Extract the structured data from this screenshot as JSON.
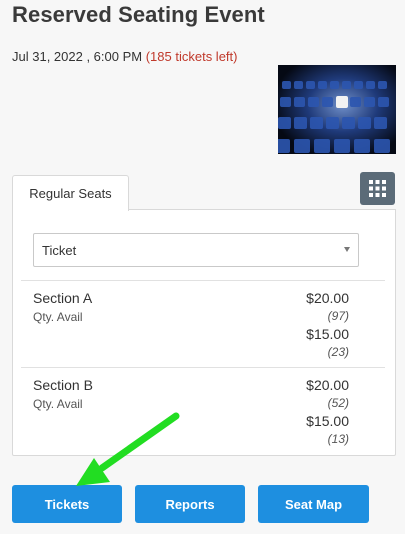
{
  "event": {
    "title": "Reserved Seating Event",
    "datetime": "Jul 31, 2022 , 6:00 PM",
    "tickets_left": "(185 tickets left)"
  },
  "tabs": [
    {
      "label": "Regular Seats"
    }
  ],
  "ticket_select": {
    "value": "Ticket"
  },
  "sections": [
    {
      "name": "Section A",
      "qty_label": "Qty. Avail",
      "prices": [
        {
          "price": "$20.00",
          "avail": "(97)"
        },
        {
          "price": "$15.00",
          "avail": "(23)"
        }
      ]
    },
    {
      "name": "Section B",
      "qty_label": "Qty. Avail",
      "prices": [
        {
          "price": "$20.00",
          "avail": "(52)"
        },
        {
          "price": "$15.00",
          "avail": "(13)"
        }
      ]
    }
  ],
  "buttons": {
    "tickets": "Tickets",
    "reports": "Reports",
    "seat_map": "Seat Map"
  },
  "colors": {
    "accent": "#1e8fe0",
    "tickets_left": "#c0392b",
    "annotation_arrow": "#22dd22"
  },
  "icons": {
    "grid_button": "grid-icon",
    "annotation": "arrow-icon"
  }
}
